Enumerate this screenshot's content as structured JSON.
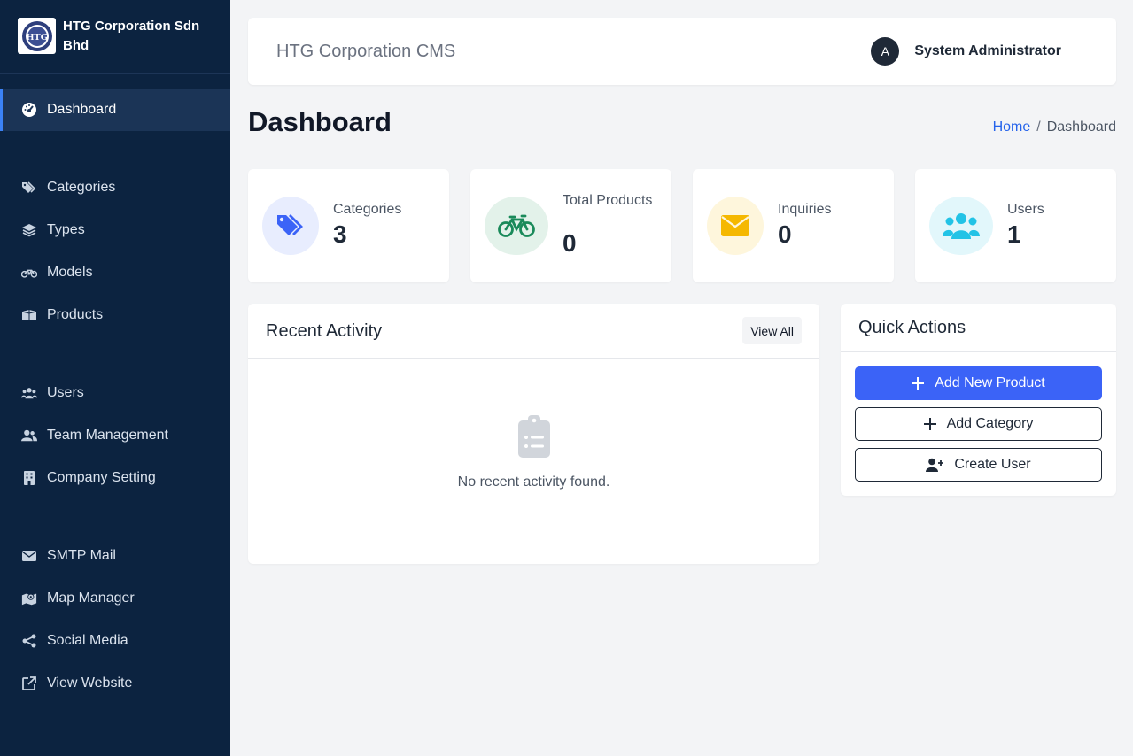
{
  "brand": {
    "name": "HTG Corporation Sdn Bhd",
    "logo_text": "HTG"
  },
  "sidebar": {
    "items": [
      {
        "label": "Dashboard",
        "icon": "gauge-icon"
      },
      {
        "label": "Categories",
        "icon": "tags-icon"
      },
      {
        "label": "Types",
        "icon": "layers-icon"
      },
      {
        "label": "Models",
        "icon": "motorcycle-icon"
      },
      {
        "label": "Products",
        "icon": "boxes-icon"
      },
      {
        "label": "Users",
        "icon": "users-icon"
      },
      {
        "label": "Team Management",
        "icon": "user-group-icon"
      },
      {
        "label": "Company Setting",
        "icon": "building-icon"
      },
      {
        "label": "SMTP Mail",
        "icon": "envelope-icon"
      },
      {
        "label": "Map Manager",
        "icon": "map-marker-icon"
      },
      {
        "label": "Social Media",
        "icon": "share-icon"
      },
      {
        "label": "View Website",
        "icon": "external-link-icon"
      }
    ]
  },
  "header": {
    "title": "HTG Corporation CMS",
    "user_initial": "A",
    "user_name": "System Administrator"
  },
  "page": {
    "title": "Dashboard",
    "breadcrumb": {
      "home": "Home",
      "separator": "/",
      "current": "Dashboard"
    }
  },
  "stats": [
    {
      "label": "Categories",
      "value": "3",
      "icon": "tags-icon",
      "color": "#3b63f7",
      "bg": "#e8edfe"
    },
    {
      "label": "Total Products",
      "value": "0",
      "icon": "bicycle-icon",
      "color": "#1a8a5a",
      "bg": "#e3f2ea"
    },
    {
      "label": "Inquiries",
      "value": "0",
      "icon": "envelope-icon",
      "color": "#f5b800",
      "bg": "#fef6dc"
    },
    {
      "label": "Users",
      "value": "1",
      "icon": "users-icon",
      "color": "#22c3e6",
      "bg": "#e2f7fb"
    }
  ],
  "recent": {
    "title": "Recent Activity",
    "view_all": "View All",
    "empty_text": "No recent activity found.",
    "empty_icon": "clipboard-list-icon"
  },
  "quick": {
    "title": "Quick Actions",
    "buttons": [
      {
        "label": "Add New Product",
        "icon": "plus-icon"
      },
      {
        "label": "Add Category",
        "icon": "plus-icon"
      },
      {
        "label": "Create User",
        "icon": "user-plus-icon"
      }
    ]
  },
  "colors": {
    "sidebar_bg": "#0c2340",
    "accent": "#3b63f7",
    "page_bg": "#f3f4f6"
  }
}
